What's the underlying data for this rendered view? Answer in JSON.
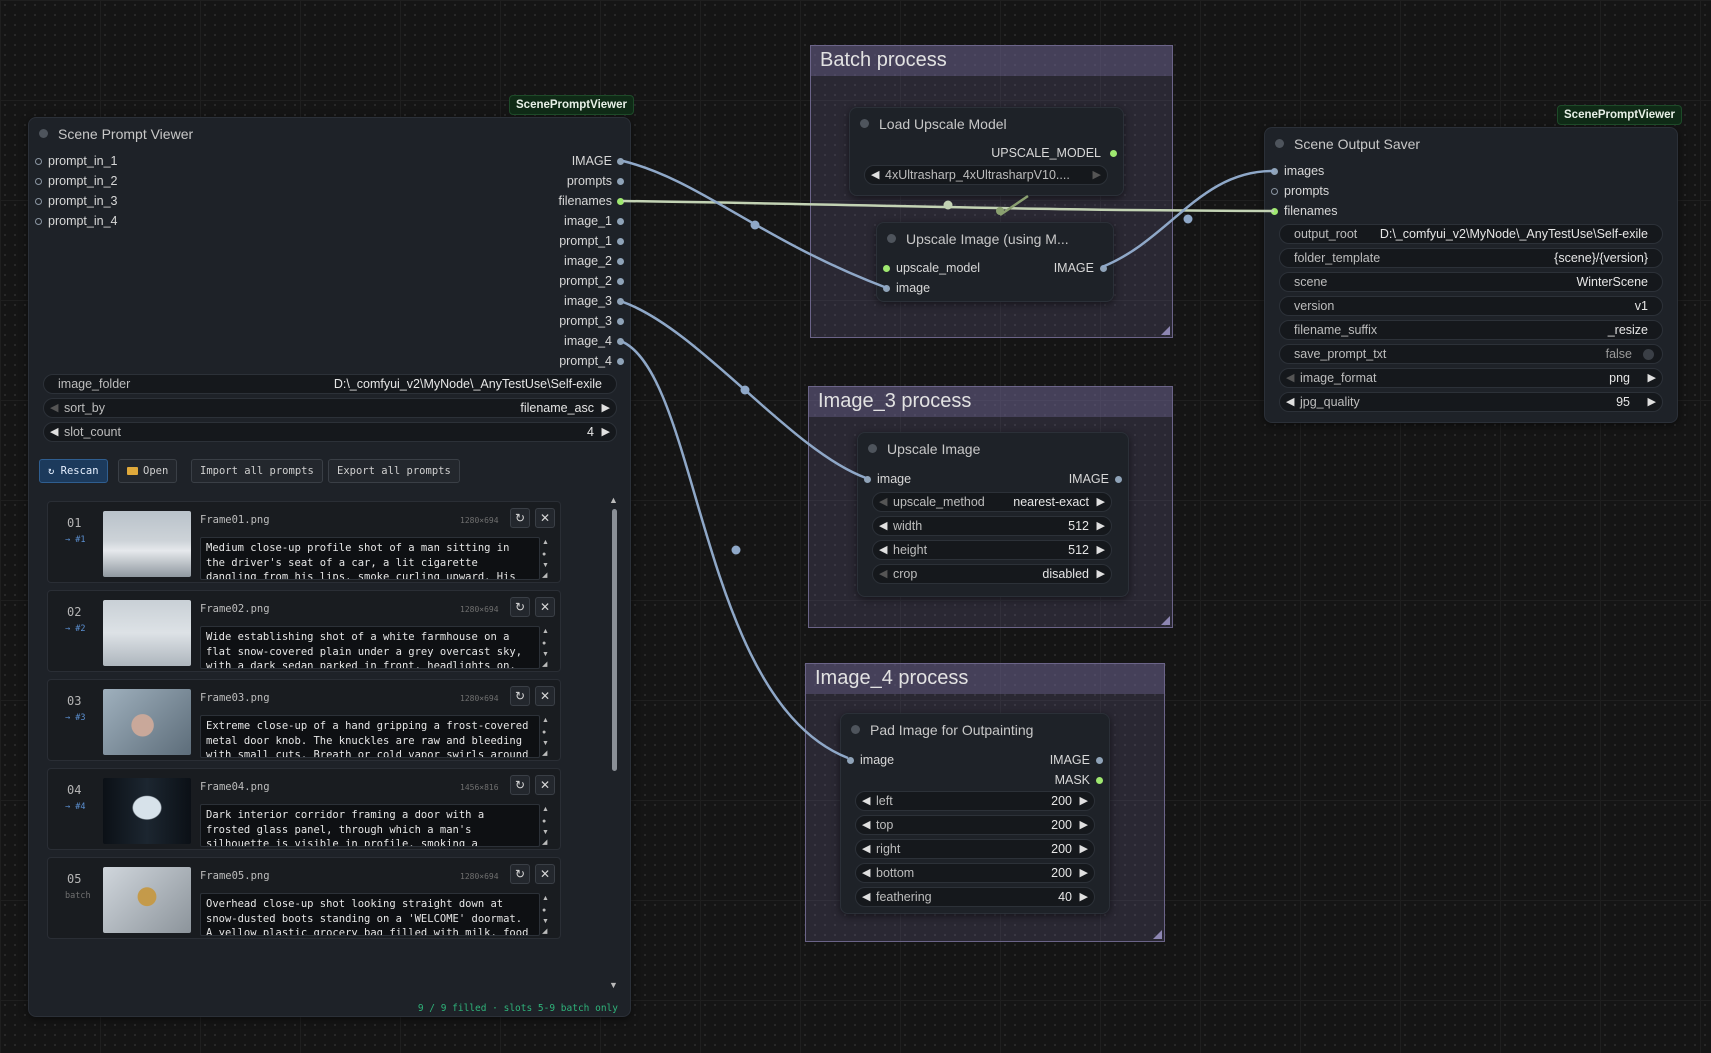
{
  "colors": {
    "canvas": "#151515",
    "node_bg": "#1e2228",
    "wire": "#8fa8c8",
    "wire_filenames": "#c3d3b4",
    "pin_green": "#9fe870",
    "group_bg": "#4a4466",
    "badge_bg": "#0f2a16"
  },
  "viewer": {
    "badge": "ScenePromptViewer",
    "title": "Scene Prompt Viewer",
    "inputs": [
      "prompt_in_1",
      "prompt_in_2",
      "prompt_in_3",
      "prompt_in_4"
    ],
    "outputs": [
      "IMAGE",
      "prompts",
      "filenames",
      "image_1",
      "prompt_1",
      "image_2",
      "prompt_2",
      "image_3",
      "prompt_3",
      "image_4",
      "prompt_4"
    ],
    "image_folder": {
      "label": "image_folder",
      "value": "D:\\_comfyui_v2\\MyNode\\_AnyTestUse\\Self-exile"
    },
    "sort_by": {
      "label": "sort_by",
      "value": "filename_asc"
    },
    "slot_count": {
      "label": "slot_count",
      "value": "4"
    },
    "buttons": {
      "rescan": "↻ Rescan",
      "open": "Open",
      "import": "Import all prompts",
      "export": "Export all prompts"
    },
    "frames": [
      {
        "num": "01",
        "tag": "→ #1",
        "name": "Frame01.png",
        "dims": "1280×694",
        "prompt": "Medium close-up profile shot of a man sitting in the driver's seat of a car, a lit cigarette dangling from his lips, smoke curling upward. His gaze is fixed forward with a cold, hollow expression. Dashboard glow faintly paces"
      },
      {
        "num": "02",
        "tag": "→ #2",
        "name": "Frame02.png",
        "dims": "1280×694",
        "prompt": "Wide establishing shot of a white farmhouse on a flat snow-covered plain under a grey overcast sky, with a dark sedan parked in front, headlights on, smoke rising from two chimneys. The car introduces tension into an otherwise"
      },
      {
        "num": "03",
        "tag": "→ #3",
        "name": "Frame03.png",
        "dims": "1280×694",
        "prompt": "Extreme close-up of a hand gripping a frost-covered metal door knob. The knuckles are raw and bleeding with small cuts. Breath or cold vapor swirls around the hand. The light framing isolates the moment — the threshold between"
      },
      {
        "num": "04",
        "tag": "→ #4",
        "name": "Frame04.png",
        "dims": "1456×816",
        "prompt": "Dark interior corridor framing a door with a frosted glass panel, through which a man's silhouette is visible in profile, smoking a cigarette — the ember glowing amber. Smoke drifts upward into the cold blue light filtering"
      },
      {
        "num": "05",
        "tag": "batch",
        "name": "Frame05.png",
        "dims": "1280×694",
        "prompt": "Overhead close-up shot looking straight down at snow-dusted boots standing on a 'WELCOME' doormat. A yellow plastic grocery bag filled with milk, food boxes, and canned goods sits on the mat. Composition is direct and"
      }
    ],
    "footer": "9 / 9 filled · slots 5-9 batch only"
  },
  "groups": {
    "batch": "Batch process",
    "image3": "Image_3 process",
    "image4": "Image_4 process"
  },
  "load_upscale": {
    "title": "Load Upscale Model",
    "output": "UPSCALE_MODEL",
    "model_name": "4xUltrasharp_4xUltrasharpV10...."
  },
  "upscale_using": {
    "title": "Upscale Image (using M...",
    "in1": "upscale_model",
    "in2": "image",
    "output": "IMAGE"
  },
  "upscale_image": {
    "title": "Upscale Image",
    "input": "image",
    "output": "IMAGE",
    "widgets": [
      {
        "label": "upscale_method",
        "value": "nearest-exact"
      },
      {
        "label": "width",
        "value": "512"
      },
      {
        "label": "height",
        "value": "512"
      },
      {
        "label": "crop",
        "value": "disabled"
      }
    ]
  },
  "pad": {
    "title": "Pad Image for Outpainting",
    "input": "image",
    "out1": "IMAGE",
    "out2": "MASK",
    "widgets": [
      {
        "label": "left",
        "value": "200"
      },
      {
        "label": "top",
        "value": "200"
      },
      {
        "label": "right",
        "value": "200"
      },
      {
        "label": "bottom",
        "value": "200"
      },
      {
        "label": "feathering",
        "value": "40"
      }
    ]
  },
  "saver": {
    "badge": "ScenePromptViewer",
    "title": "Scene Output Saver",
    "inputs": [
      "images",
      "prompts",
      "filenames"
    ],
    "widgets": [
      {
        "label": "output_root",
        "value": "D:\\_comfyui_v2\\MyNode\\_AnyTestUse\\Self-exile"
      },
      {
        "label": "folder_template",
        "value": "{scene}/{version}"
      },
      {
        "label": "scene",
        "value": "WinterScene"
      },
      {
        "label": "version",
        "value": "v1"
      },
      {
        "label": "filename_suffix",
        "value": "_resize"
      },
      {
        "label": "save_prompt_txt",
        "value": "false"
      },
      {
        "label": "image_format",
        "value": "png"
      },
      {
        "label": "jpg_quality",
        "value": "95"
      }
    ]
  }
}
